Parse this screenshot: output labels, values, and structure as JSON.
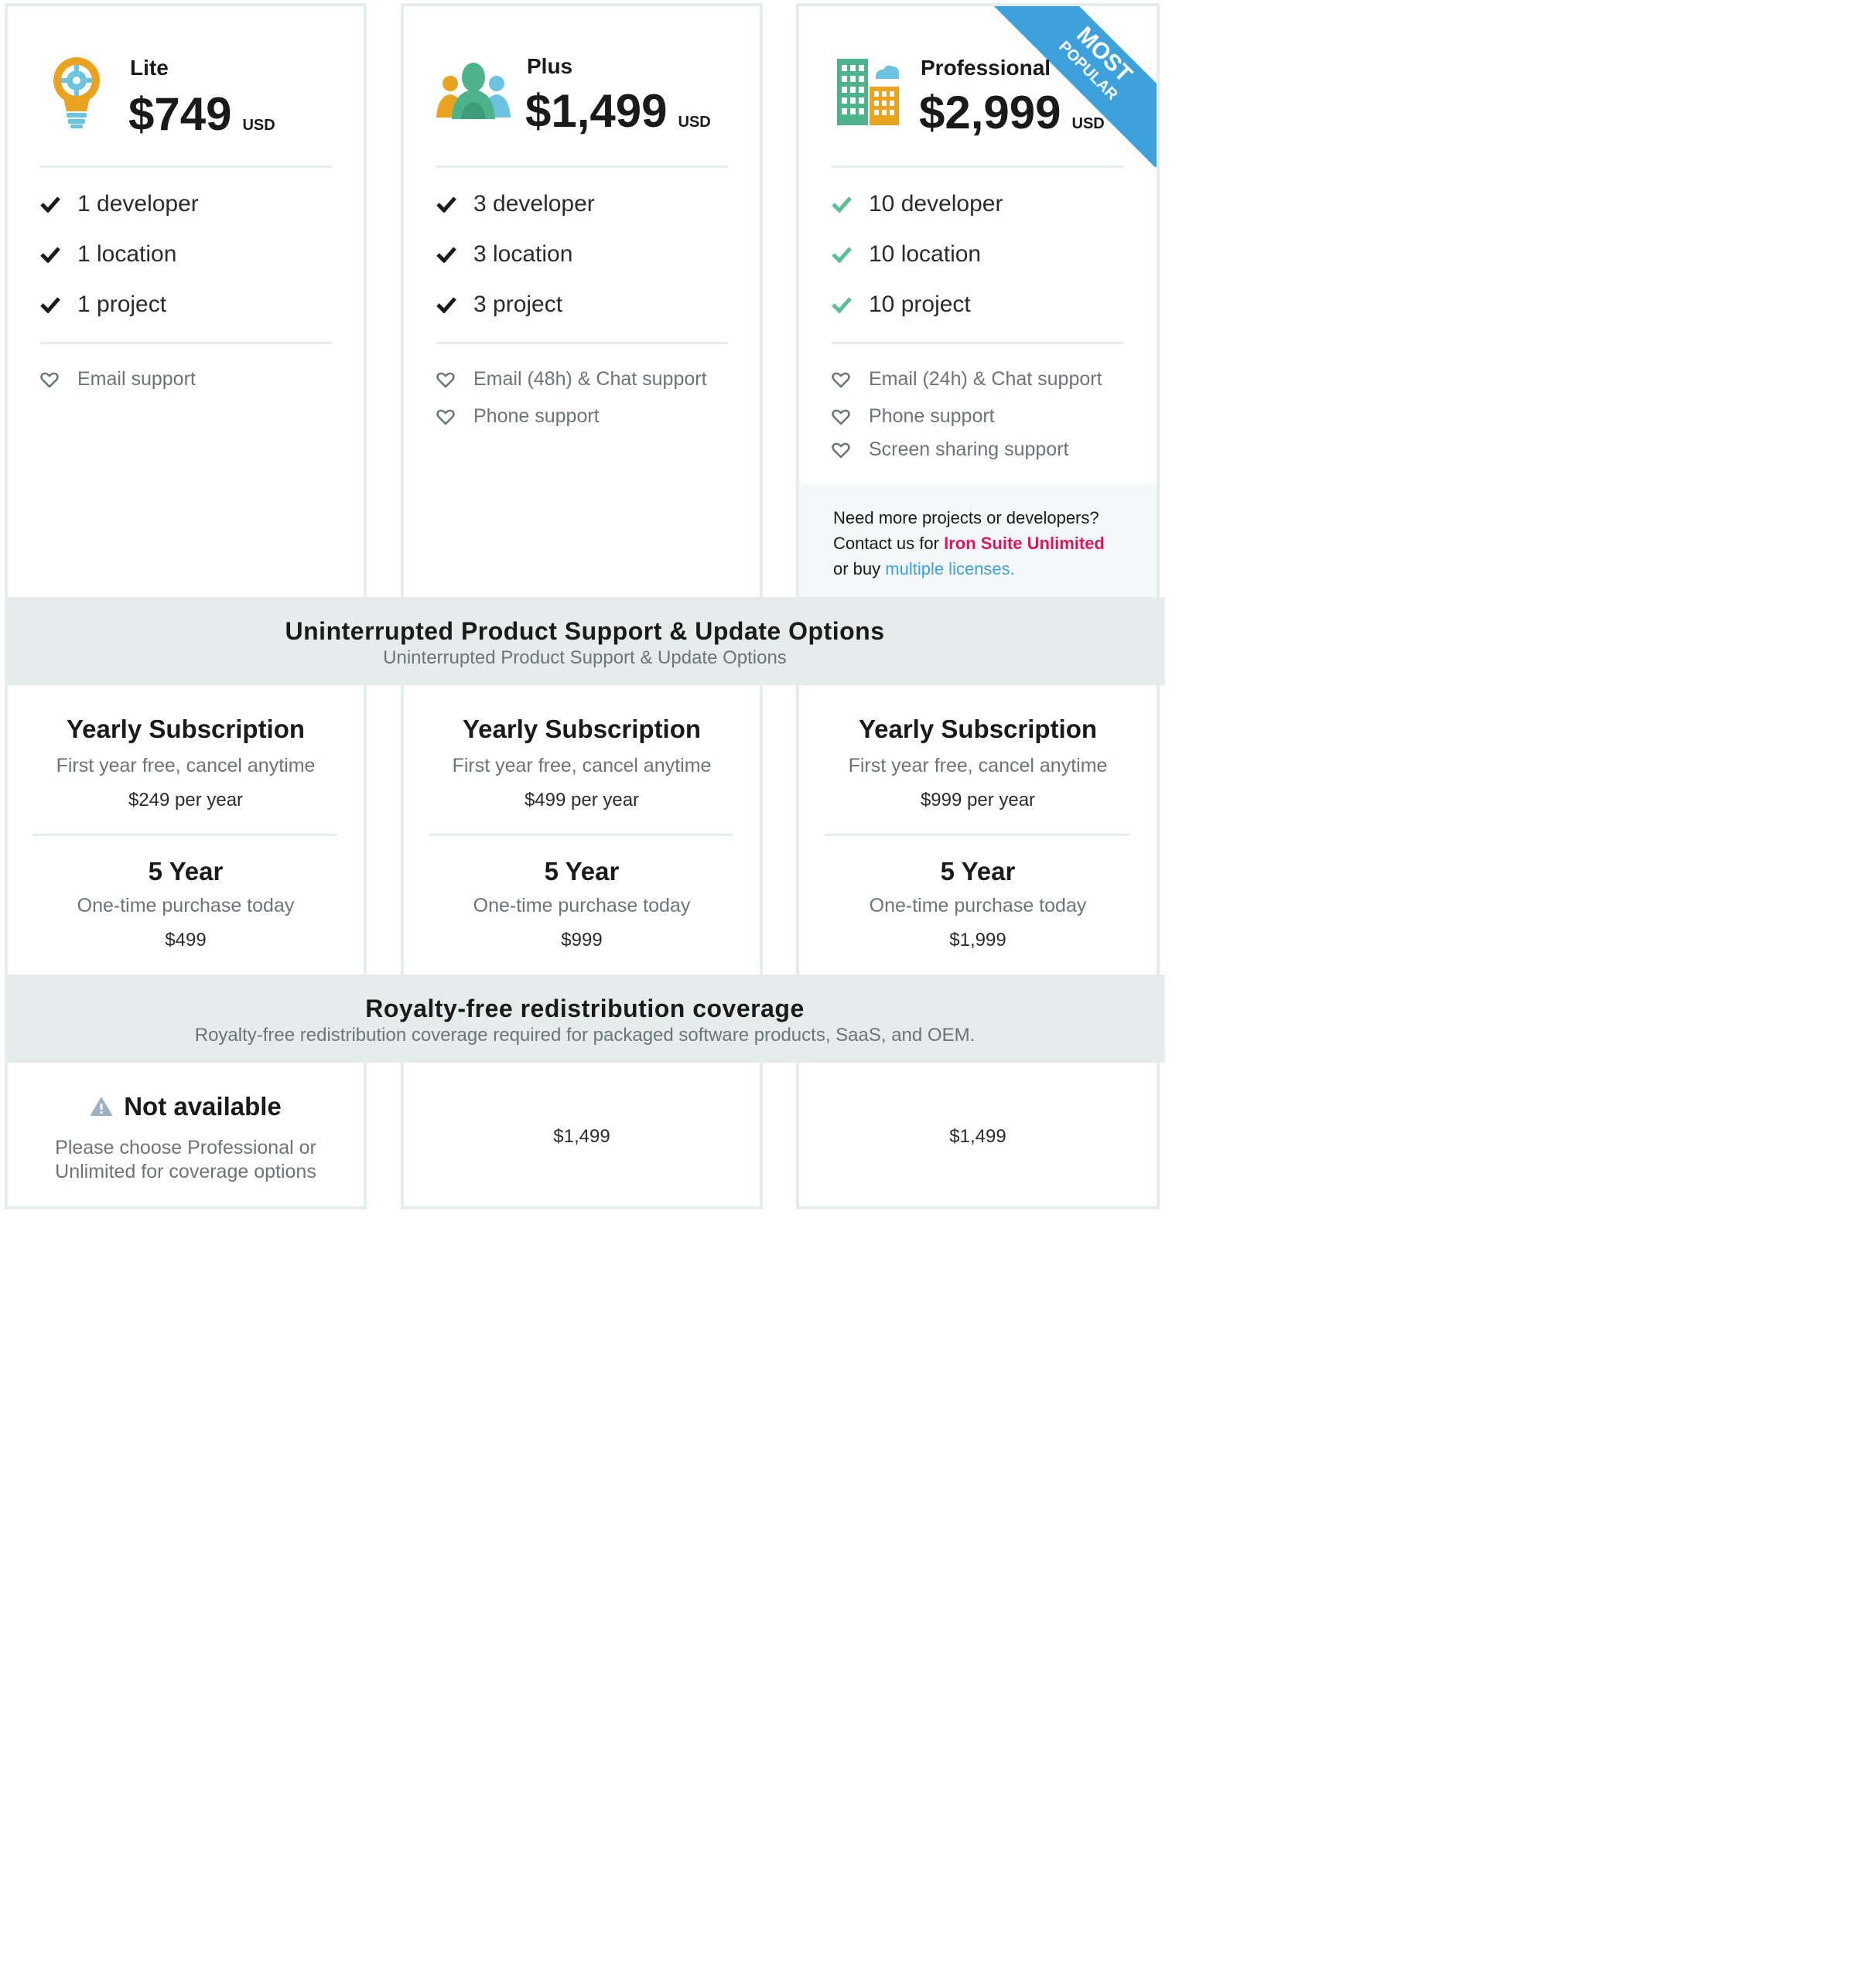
{
  "plans": [
    {
      "name": "Lite",
      "price": "$749",
      "currency": "USD",
      "icon": "lightbulb-gear-icon",
      "features": [
        "1 developer",
        "1 location",
        "1 project"
      ],
      "support": [
        "Email support"
      ],
      "yearly": {
        "title": "Yearly Subscription",
        "desc": "First year free, cancel anytime",
        "price": "$249 per year"
      },
      "five_year": {
        "title": "5 Year",
        "desc": "One-time purchase today",
        "price": "$499"
      }
    },
    {
      "name": "Plus",
      "price": "$1,499",
      "currency": "USD",
      "icon": "team-people-icon",
      "features": [
        "3 developer",
        "3 location",
        "3 project"
      ],
      "support": [
        "Email (48h) & Chat support",
        "Phone support"
      ],
      "yearly": {
        "title": "Yearly Subscription",
        "desc": "First year free, cancel anytime",
        "price": "$499 per year"
      },
      "five_year": {
        "title": "5 Year",
        "desc": "One-time purchase today",
        "price": "$999"
      },
      "royalty": "$1,499"
    },
    {
      "name": "Professional",
      "price": "$2,999",
      "currency": "USD",
      "icon": "office-buildings-icon",
      "ribbon": {
        "line1": "MOST",
        "line2": "POPULAR"
      },
      "features": [
        "10 developer",
        "10 location",
        "10 project"
      ],
      "support": [
        "Email (24h) & Chat support",
        "Phone support",
        "Screen sharing support"
      ],
      "note": {
        "line1": "Need more projects or developers?",
        "line2_prefix": "Contact us for ",
        "line2_link": "Iron Suite Unlimited",
        "line3_prefix": "or buy ",
        "line3_link": "multiple licenses."
      },
      "yearly": {
        "title": "Yearly Subscription",
        "desc": "First year free, cancel anytime",
        "price": "$999 per year"
      },
      "five_year": {
        "title": "5 Year",
        "desc": "One-time purchase today",
        "price": "$1,999"
      },
      "royalty": "$1,499"
    }
  ],
  "sections": {
    "support": {
      "title": "Uninterrupted Product Support & Update Options",
      "subtitle": "Uninterrupted Product Support & Update Options"
    },
    "royalty": {
      "title": "Royalty-free redistribution coverage",
      "subtitle": "Royalty-free redistribution coverage required for packaged software products, SaaS, and OEM."
    }
  },
  "lite_royalty": {
    "title": "Not available",
    "desc_line1": "Please choose Professional or",
    "desc_line2": "Unlimited for coverage options",
    "icon": "warning-icon"
  },
  "colors": {
    "accent_teal": "#5bbf96",
    "ribbon_blue": "#3ea1dc",
    "link_pink": "#d6185a",
    "link_blue": "#3ea1dc",
    "band_gray": "#e5ecec"
  }
}
